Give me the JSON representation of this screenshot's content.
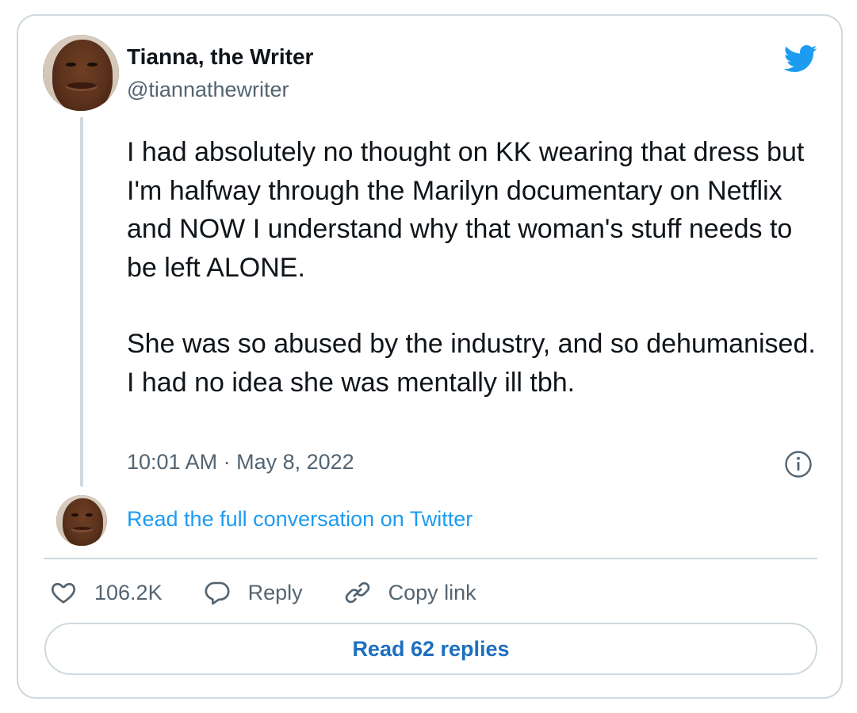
{
  "author": {
    "name": "Tianna, the Writer",
    "handle": "@tiannathewriter"
  },
  "tweet": {
    "paragraphs": [
      "I had absolutely no thought on KK wearing that dress but I'm halfway through the Marilyn documentary on Netflix and NOW I understand why that woman's stuff needs to be left ALONE.",
      "She was so abused by the industry, and so dehumanised. I had no idea she was mentally ill tbh."
    ],
    "timestamp": "10:01 AM · May 8, 2022"
  },
  "conversation_link": "Read the full conversation on Twitter",
  "actions": {
    "like_count": "106.2K",
    "reply_label": "Reply",
    "copy_link_label": "Copy link"
  },
  "replies_button": "Read 62 replies",
  "colors": {
    "accent": "#1d9bf0",
    "link_dark": "#1d6fbf",
    "secondary_text": "#536471",
    "border": "#cfd9de"
  },
  "icons": [
    "twitter-bird-icon",
    "info-icon",
    "heart-icon",
    "reply-icon",
    "link-icon"
  ]
}
